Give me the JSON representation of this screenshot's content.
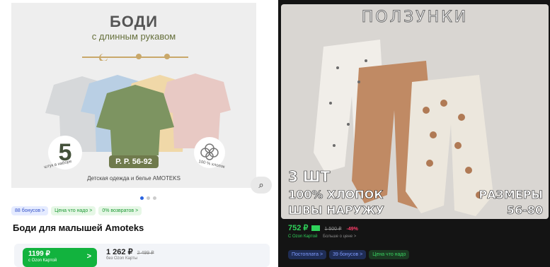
{
  "left_card": {
    "image": {
      "title": "БОДИ",
      "subtitle": "с длинным рукавом",
      "count_number": "5",
      "count_caption": "штук в наборе",
      "size_badge": "Р. Р. 56-92",
      "cotton_caption": "100 % хлопок",
      "caption": "Детская одежда и белье AMOTEKS"
    },
    "carousel": {
      "total_dots": 3,
      "active_index": 0
    },
    "chips": [
      {
        "label": "88 бонусов >",
        "style": "blue"
      },
      {
        "label": "Цена что надо >",
        "style": "green"
      },
      {
        "label": "0% возвратов >",
        "style": "green"
      }
    ],
    "title": "Боди для малышей Amoteks",
    "price_card": {
      "amount": "1199 ₽",
      "label": "с Ozon Картой",
      "arrow": ">"
    },
    "price_regular": {
      "amount": "1 262 ₽",
      "old": "2 499 ₽",
      "label": "без Ozon Карты"
    }
  },
  "right_card": {
    "image": {
      "title": "ПОЛЗУНКИ",
      "qty": "3 ШТ",
      "cotton": "100% ХЛОПОК",
      "seams": "ШВЫ НАРУЖУ",
      "sizes_label": "РАЗМЕРЫ",
      "sizes_value": "56-80"
    },
    "price": "752 ₽",
    "old_price": "1 500 ₽",
    "discount": "-49%",
    "card_label": "С Ozon Картой",
    "card_note": "Больше о цене >",
    "chips": [
      {
        "label": "Постоплата >",
        "style": "blue"
      },
      {
        "label": "39 бонусов >",
        "style": "blue"
      },
      {
        "label": "Цена что надо",
        "style": "green"
      }
    ]
  },
  "colors": {
    "ozon_green": "#12b33e",
    "dark_bg": "#141414",
    "carousel_active": "#2a63e0"
  }
}
